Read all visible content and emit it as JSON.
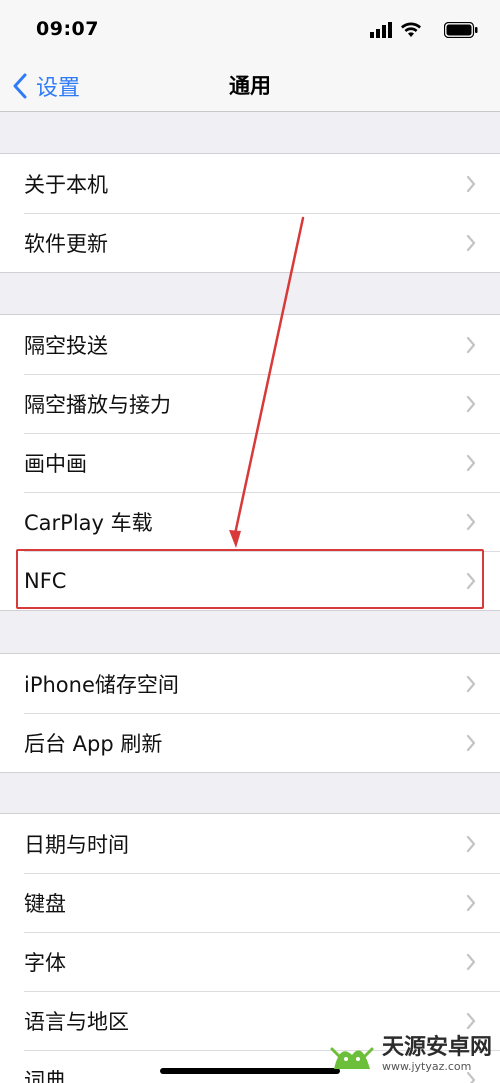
{
  "status_bar": {
    "time": "09:07"
  },
  "nav": {
    "back_label": "设置",
    "title": "通用"
  },
  "groups": [
    {
      "items": [
        {
          "label": "关于本机"
        },
        {
          "label": "软件更新"
        }
      ]
    },
    {
      "items": [
        {
          "label": "隔空投送"
        },
        {
          "label": "隔空播放与接力"
        },
        {
          "label": "画中画"
        },
        {
          "label": "CarPlay 车载"
        },
        {
          "label": "NFC"
        }
      ]
    },
    {
      "items": [
        {
          "label": "iPhone储存空间"
        },
        {
          "label": "后台 App 刷新"
        }
      ]
    },
    {
      "items": [
        {
          "label": "日期与时间"
        },
        {
          "label": "键盘"
        },
        {
          "label": "字体"
        },
        {
          "label": "语言与地区"
        },
        {
          "label": "词典"
        }
      ]
    }
  ],
  "annotation": {
    "highlighted_item": "NFC",
    "color": "#d83a3a"
  },
  "colors": {
    "accent": "#2f7cf6",
    "background": "#efeff4",
    "annotation_red": "#d83a3a"
  },
  "watermark": {
    "title": "天源安卓网",
    "url": "www.jytyaz.com"
  }
}
